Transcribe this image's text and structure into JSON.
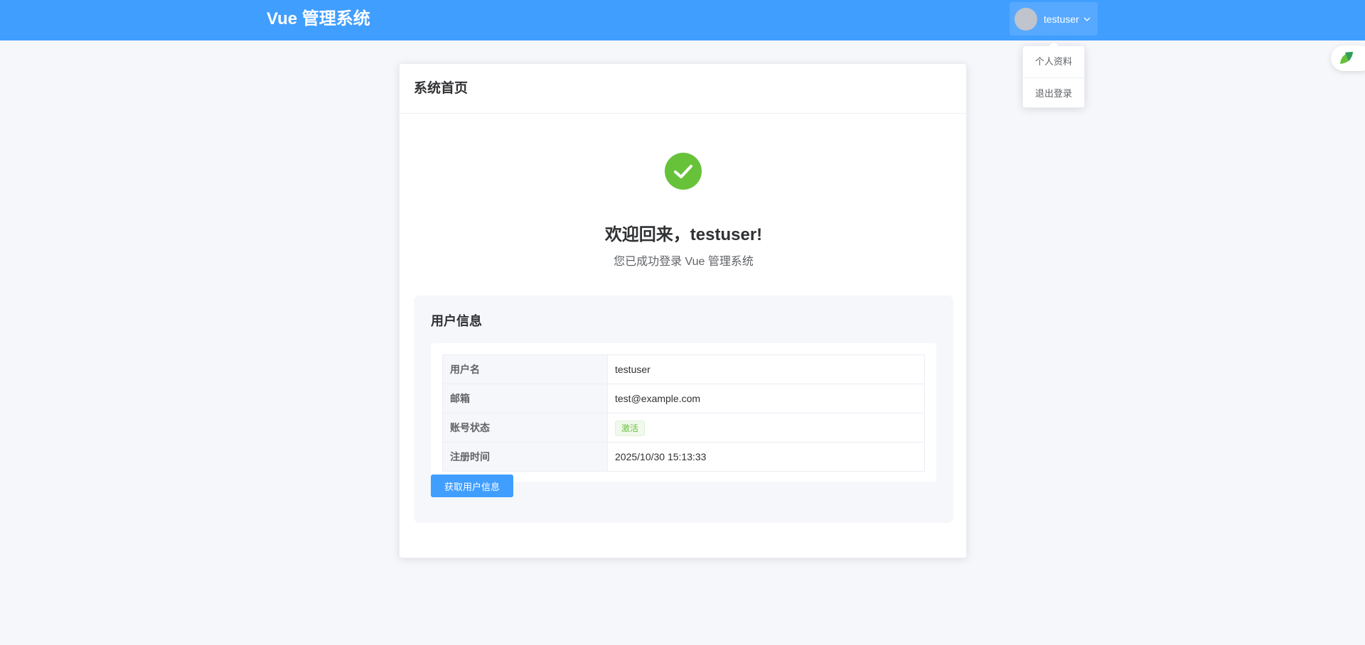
{
  "header": {
    "app_title": "Vue 管理系统",
    "user_name": "testuser"
  },
  "dropdown": {
    "items": [
      {
        "label": "个人资料"
      },
      {
        "label": "退出登录"
      }
    ]
  },
  "card": {
    "title": "系统首页",
    "welcome": "欢迎回来，testuser!",
    "subtitle": "您已成功登录 Vue 管理系统"
  },
  "user_info": {
    "title": "用户信息",
    "rows": [
      {
        "label": "用户名",
        "value": "testuser"
      },
      {
        "label": "邮箱",
        "value": "test@example.com"
      },
      {
        "label": "账号状态",
        "value": "激活"
      },
      {
        "label": "注册时间",
        "value": "2025/10/30 15:13:33"
      }
    ],
    "fetch_button": "获取用户信息"
  },
  "colors": {
    "primary": "#409eff",
    "success": "#67c23a",
    "background": "#f5f7fa"
  },
  "icons": {
    "user_menu": "chevron-down-icon",
    "success": "check-circle-icon",
    "side_float": "leaf-icon"
  }
}
